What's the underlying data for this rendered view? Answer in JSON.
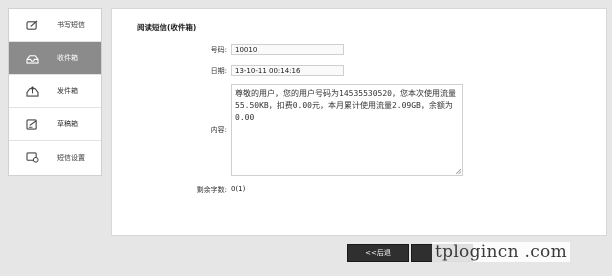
{
  "sidebar": {
    "items": [
      {
        "label": "书写短信",
        "icon": "compose-icon"
      },
      {
        "label": "收件箱",
        "icon": "inbox-icon"
      },
      {
        "label": "发件箱",
        "icon": "outbox-icon"
      },
      {
        "label": "草稿箱",
        "icon": "drafts-icon"
      },
      {
        "label": "短信设置",
        "icon": "sms-settings-icon"
      }
    ],
    "active_index": 1
  },
  "main": {
    "title": "阅读短信(收件箱)",
    "number_label": "号码:",
    "number_value": "10010",
    "date_label": "日期:",
    "date_value": "13-10-11 00:14:16",
    "content_label": "内容:",
    "content_text": "尊敬的用户，您的用户号码为14535530520，您本次使用流量55.50KB，扣费0.00元，本月累计使用流量2.09GB，余额为0.00",
    "remaining_label": "剩余字数:",
    "remaining_value": "0(1)"
  },
  "buttons": {
    "back_label": "<<后退"
  },
  "watermark": "tplogincn .com",
  "colors": {
    "active_sidebar": "#8b8b8b",
    "button_dark": "#2f2f2f"
  }
}
